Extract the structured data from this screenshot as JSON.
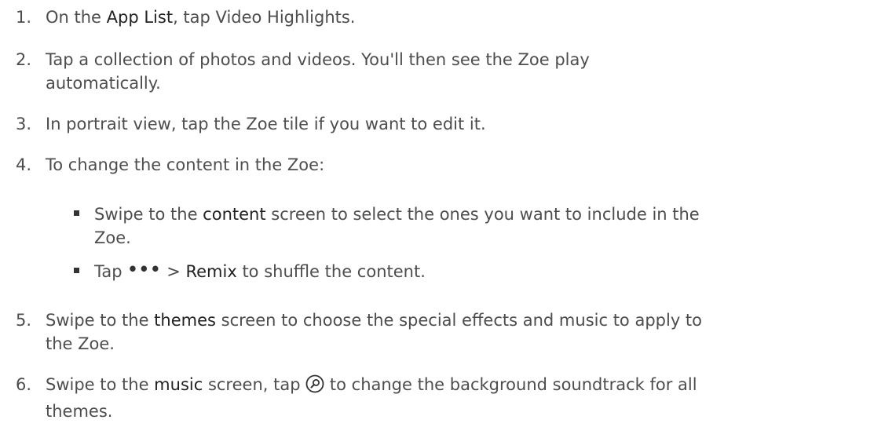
{
  "steps": [
    {
      "n": "1.",
      "a": "On the ",
      "b": "App List",
      "c": ", tap Video Highlights."
    },
    {
      "n": "2.",
      "line1": "Tap a collection of photos and videos. You'll then see the Zoe play",
      "line2": "automatically."
    },
    {
      "n": "3.",
      "text": "In portrait view, tap the Zoe tile if you want to edit it."
    },
    {
      "n": "4.",
      "text": "To change the content in the Zoe:"
    },
    {
      "n": "5.",
      "a": "Swipe to the ",
      "b": "themes",
      "c1": " screen to choose the special effects and music to apply to",
      "line2": "the Zoe."
    },
    {
      "n": "6.",
      "a": "Swipe to the ",
      "b": "music",
      "c": " screen, tap ",
      "d": " to change the background soundtrack for all",
      "line2": "themes."
    }
  ],
  "bullets": [
    {
      "a": "Swipe to the ",
      "b": "content",
      "c": " screen to select the ones you want to include in the",
      "line2": "Zoe."
    },
    {
      "a": "Tap ",
      "icon": "•••",
      "b": " > ",
      "c": "Remix",
      "d": " to shuffle the content."
    }
  ],
  "icons": {
    "more": "more-options-icon",
    "search": "search-icon"
  }
}
